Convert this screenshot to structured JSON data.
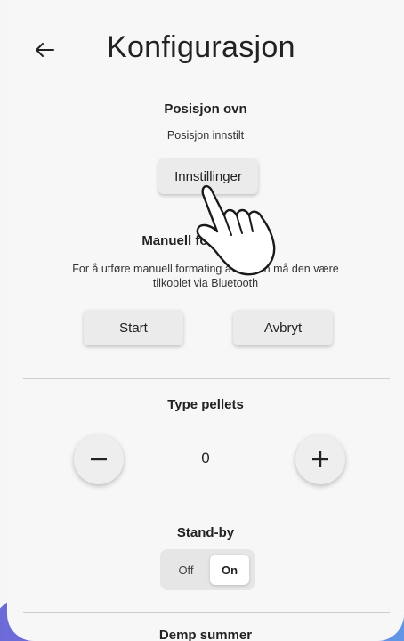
{
  "header": {
    "title": "Konfigurasjon",
    "back_icon": "arrow-left-icon"
  },
  "position": {
    "title": "Posisjon ovn",
    "subtitle": "Posisjon innstilt",
    "settings_label": "Innstillinger"
  },
  "manual": {
    "title": "Manuell formatering",
    "description_line1": "For å utføre manuell formating av ovnen må den være",
    "description_line2": "tilkoblet via Bluetooth",
    "start_label": "Start",
    "cancel_label": "Avbryt"
  },
  "pellets": {
    "title": "Type pellets",
    "value": "0",
    "minus_label": "−",
    "plus_label": "+"
  },
  "standby": {
    "title": "Stand-by",
    "off_label": "Off",
    "on_label": "On",
    "selected": "On"
  },
  "next_section": {
    "title": "Demp summer"
  },
  "colors": {
    "accent": "#7a74dc",
    "background": "#f8f7f7"
  }
}
